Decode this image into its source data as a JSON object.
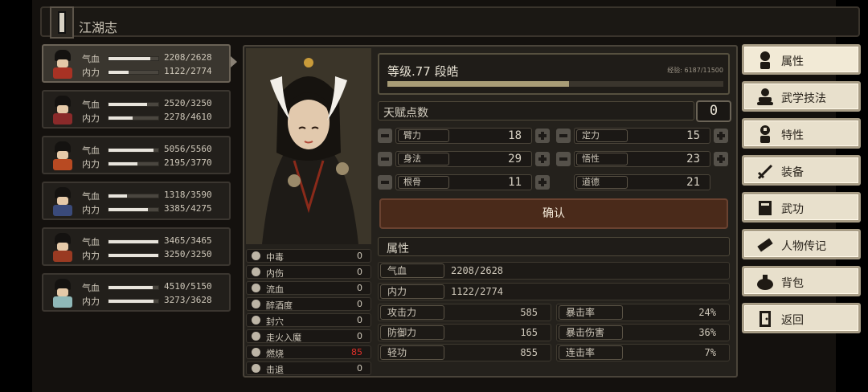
{
  "header": {
    "title": "江湖志"
  },
  "party": [
    {
      "hp_label": "气血",
      "hp": "2208/2628",
      "hp_ratio": 0.84,
      "mp_label": "内力",
      "mp": "1122/2774",
      "mp_ratio": 0.4,
      "color": "#a83224"
    },
    {
      "hp_label": "气血",
      "hp": "2520/3250",
      "hp_ratio": 0.78,
      "mp_label": "内力",
      "mp": "2278/4610",
      "mp_ratio": 0.49,
      "color": "#8a2a2a"
    },
    {
      "hp_label": "气血",
      "hp": "5056/5560",
      "hp_ratio": 0.91,
      "mp_label": "内力",
      "mp": "2195/3770",
      "mp_ratio": 0.58,
      "color": "#b84a22"
    },
    {
      "hp_label": "气血",
      "hp": "1318/3590",
      "hp_ratio": 0.37,
      "mp_label": "内力",
      "mp": "3385/4275",
      "mp_ratio": 0.79,
      "color": "#3a4a7a"
    },
    {
      "hp_label": "气血",
      "hp": "3465/3465",
      "hp_ratio": 1.0,
      "mp_label": "内力",
      "mp": "3250/3250",
      "mp_ratio": 1.0,
      "color": "#9a3a22"
    },
    {
      "hp_label": "气血",
      "hp": "4510/5150",
      "hp_ratio": 0.88,
      "mp_label": "内力",
      "mp": "3273/3628",
      "mp_ratio": 0.9,
      "color": "#8fb8b8"
    }
  ],
  "status_effects": [
    {
      "name": "中毒",
      "value": "0",
      "icon": "skull-icon"
    },
    {
      "name": "内伤",
      "value": "0",
      "icon": "broken-heart-icon"
    },
    {
      "name": "流血",
      "value": "0",
      "icon": "blood-drop-icon"
    },
    {
      "name": "醉酒度",
      "value": "0",
      "icon": "dizzy-icon"
    },
    {
      "name": "封穴",
      "value": "0",
      "icon": "needle-icon"
    },
    {
      "name": "走火入魔",
      "value": "0",
      "icon": "demon-face-icon"
    },
    {
      "name": "燃烧",
      "value": "85",
      "icon": "flame-icon",
      "highlight": "#e0302a"
    },
    {
      "name": "击退",
      "value": "0",
      "icon": "boot-icon"
    }
  ],
  "level": {
    "text": "等级.77  段皓",
    "exp_text": "经验: 6187/11500",
    "exp_ratio": 0.54
  },
  "talent": {
    "label": "天赋点数",
    "value": "0"
  },
  "base_stats": [
    {
      "name": "臂力",
      "value": "18"
    },
    {
      "name": "定力",
      "value": "15"
    },
    {
      "name": "身法",
      "value": "29"
    },
    {
      "name": "悟性",
      "value": "23"
    },
    {
      "name": "根骨",
      "value": "11"
    },
    {
      "name": "道德",
      "value": "21"
    }
  ],
  "confirm_label": "确认",
  "attributes": {
    "header": "属性",
    "hp_label": "气血",
    "hp": "2208/2628",
    "mp_label": "内力",
    "mp": "1122/2774",
    "combat": [
      {
        "name": "攻击力",
        "value": "585"
      },
      {
        "name": "暴击率",
        "value": "24%"
      },
      {
        "name": "防御力",
        "value": "165"
      },
      {
        "name": "暴击伤害",
        "value": "36%"
      },
      {
        "name": "轻功",
        "value": "855"
      },
      {
        "name": "连击率",
        "value": "7%"
      }
    ]
  },
  "menu": [
    {
      "label": "属性",
      "icon": "person-icon"
    },
    {
      "label": "武学技法",
      "icon": "meditating-person-icon"
    },
    {
      "label": "特性",
      "icon": "person-star-icon"
    },
    {
      "label": "装备",
      "icon": "sword-icon"
    },
    {
      "label": "武功",
      "icon": "book-icon"
    },
    {
      "label": "人物传记",
      "icon": "scroll-icon"
    },
    {
      "label": "背包",
      "icon": "bag-icon"
    },
    {
      "label": "返回",
      "icon": "door-icon"
    }
  ]
}
